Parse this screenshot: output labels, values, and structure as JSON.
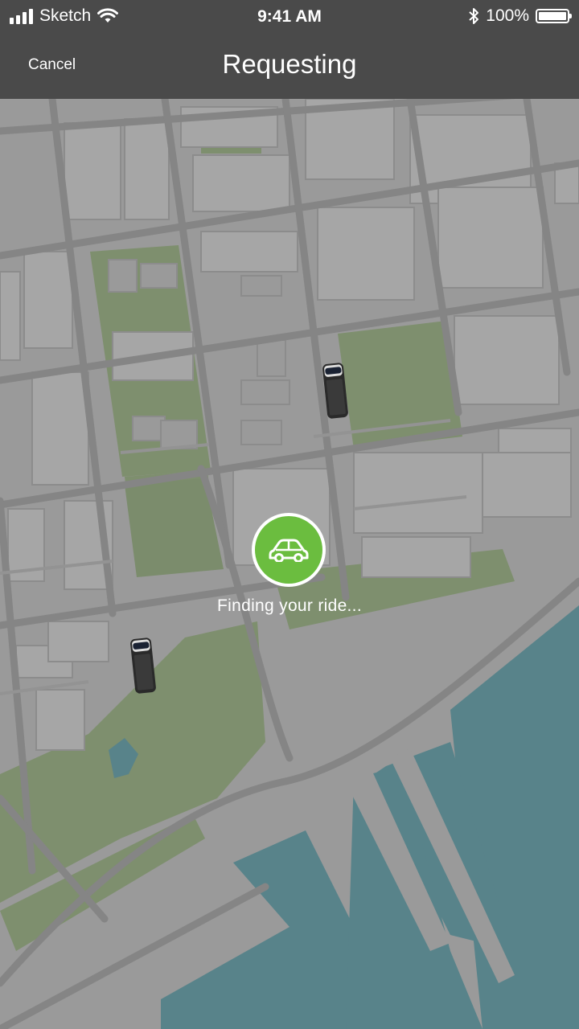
{
  "status_bar": {
    "carrier": "Sketch",
    "time": "9:41 AM",
    "battery": "100%",
    "icons": [
      "signal-icon",
      "wifi-icon",
      "bluetooth-icon",
      "battery-icon"
    ]
  },
  "nav": {
    "cancel_label": "Cancel",
    "title": "Requesting"
  },
  "map": {
    "status_text": "Finding your ride...",
    "marker_icon": "car-icon",
    "vehicles": [
      "vehicle-top",
      "vehicle-bottom"
    ]
  },
  "colors": {
    "nav_background": "#4a4a4a",
    "map_land": "#9a9a9a",
    "map_park": "#7e8f6e",
    "map_water": "#58838a",
    "marker_green": "#6bbd3f"
  }
}
